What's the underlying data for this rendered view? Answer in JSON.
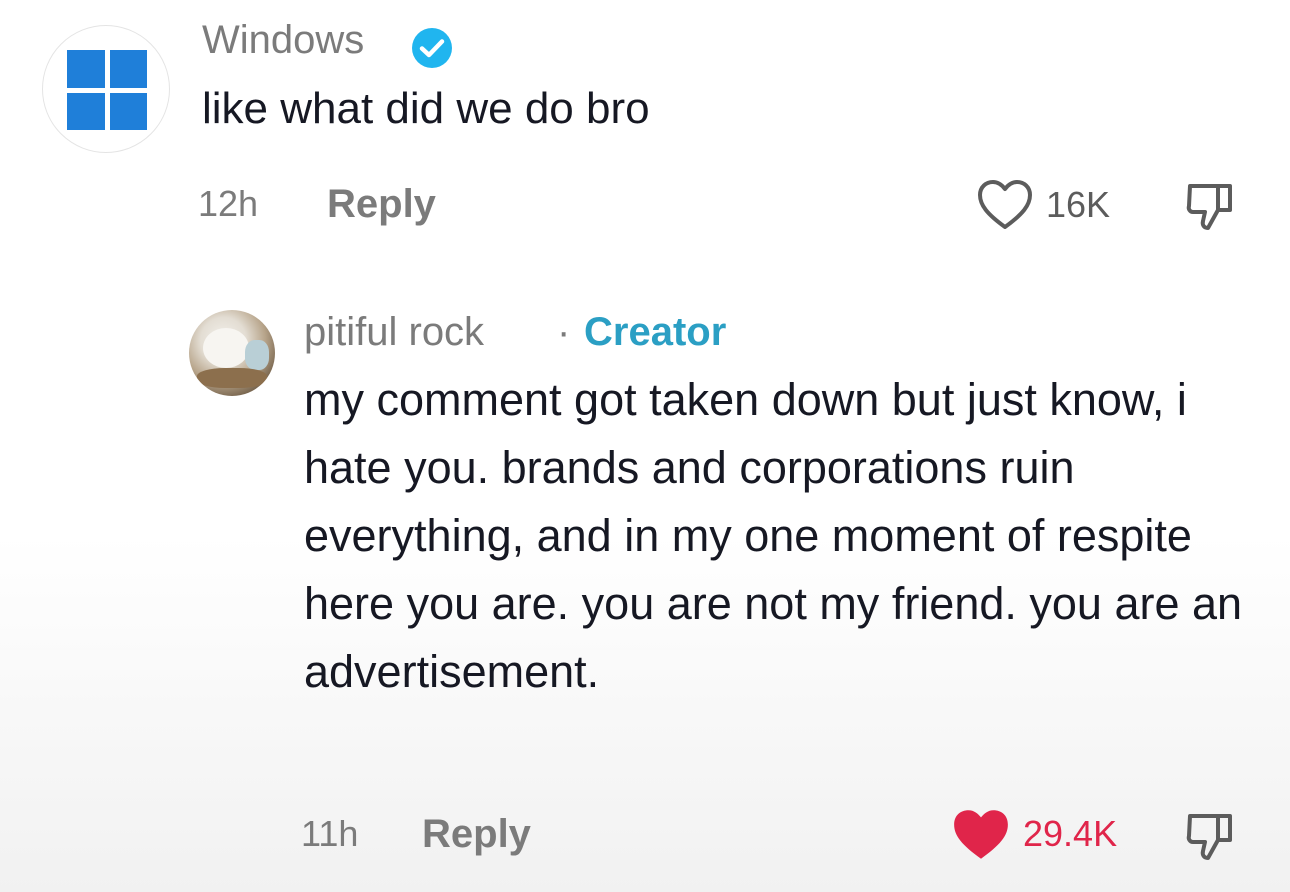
{
  "comments": [
    {
      "username": "Windows",
      "verified": true,
      "avatar_icon": "windows-logo-icon",
      "text": "like what did we do bro",
      "time": "12h",
      "reply_label": "Reply",
      "likes": "16K",
      "liked": false,
      "like_icon": "heart-outline-icon",
      "dislike_icon": "thumbs-down-icon"
    },
    {
      "username": "pitiful  rock",
      "separator": "·",
      "badge": "Creator",
      "avatar_icon": "user-avatar-photo",
      "text": "my comment got taken down but just know, i hate you. brands and corporations ruin everything, and in my one moment of respite here you are. you are not my friend. you are an advertisement.",
      "time": "11h",
      "reply_label": "Reply",
      "likes": "29.4K",
      "liked": true,
      "like_icon": "heart-filled-icon",
      "dislike_icon": "thumbs-down-icon"
    }
  ],
  "colors": {
    "text_primary": "#161823",
    "text_secondary": "#7b7b7b",
    "creator_badge": "#2b9fc4",
    "verified_badge": "#20b5ef",
    "liked_heart": "#e0254a",
    "windows_blue": "#1f7fd9"
  }
}
